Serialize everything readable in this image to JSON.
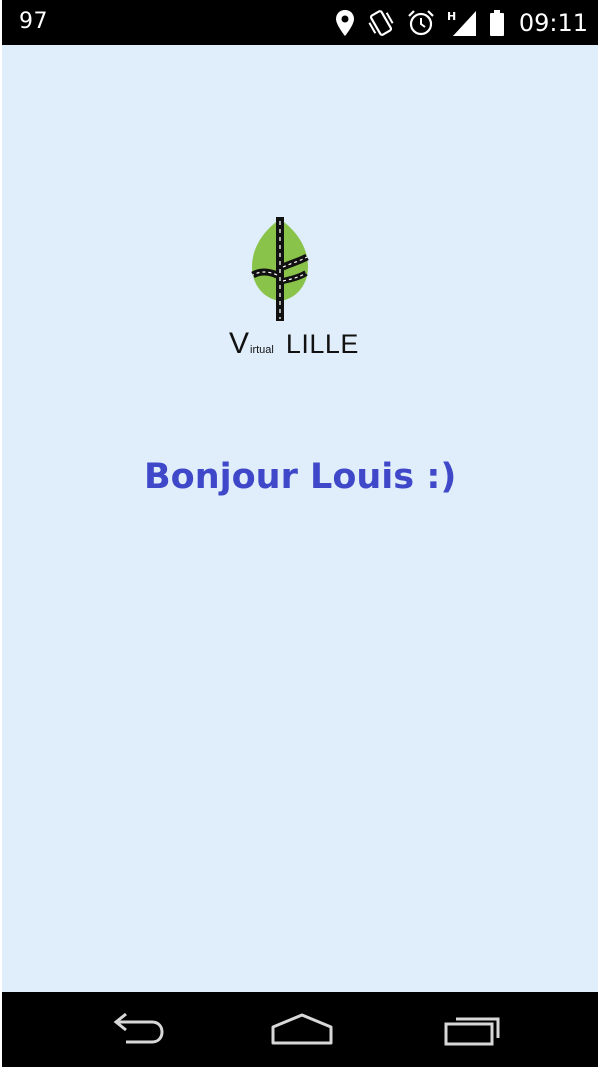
{
  "status_bar": {
    "notification_count": "97",
    "time": "09:11",
    "network_type": "H",
    "icons": [
      "location-icon",
      "vibrate-icon",
      "alarm-icon",
      "signal-icon",
      "battery-icon"
    ]
  },
  "logo": {
    "v_letter": "V",
    "subscript": "irtual",
    "city": "LILLE",
    "leaf_color": "#8ac34a",
    "road_color": "#111111"
  },
  "greeting": {
    "text": "Bonjour Louis :)",
    "color": "#3e48c8"
  },
  "nav_bar": {
    "buttons": [
      "back-icon",
      "home-icon",
      "recent-apps-icon"
    ]
  },
  "colors": {
    "background": "#e0eefc",
    "bars": "#000000"
  }
}
